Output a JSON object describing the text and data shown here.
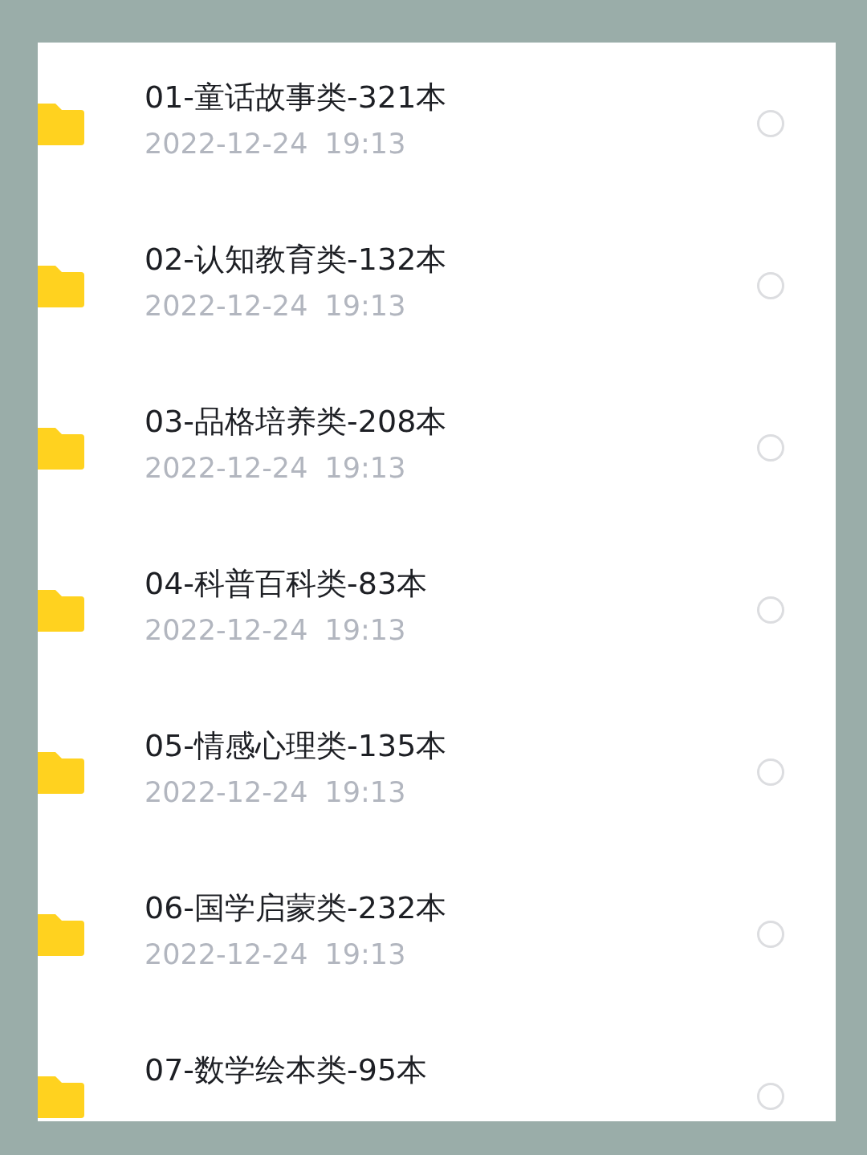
{
  "files": [
    {
      "name": "01-童话故事类-321本",
      "date": "2022-12-24 19:13",
      "selected": false
    },
    {
      "name": "02-认知教育类-132本",
      "date": "2022-12-24 19:13",
      "selected": false
    },
    {
      "name": "03-品格培养类-208本",
      "date": "2022-12-24 19:13",
      "selected": false
    },
    {
      "name": "04-科普百科类-83本",
      "date": "2022-12-24 19:13",
      "selected": false
    },
    {
      "name": "05-情感心理类-135本",
      "date": "2022-12-24 19:13",
      "selected": false
    },
    {
      "name": "06-国学启蒙类-232本",
      "date": "2022-12-24 19:13",
      "selected": false
    },
    {
      "name": "07-数学绘本类-95本",
      "selected": false
    }
  ]
}
